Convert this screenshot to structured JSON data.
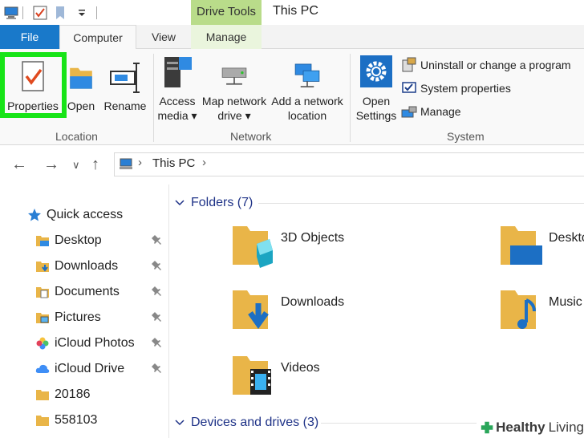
{
  "window": {
    "title": "This PC",
    "contextual_tab": "Drive Tools"
  },
  "tabs": {
    "file": "File",
    "computer": "Computer",
    "view": "View",
    "manage": "Manage"
  },
  "ribbon": {
    "location": {
      "label": "Location",
      "properties": "Properties",
      "open": "Open",
      "rename": "Rename"
    },
    "network": {
      "label": "Network",
      "access_media_1": "Access",
      "access_media_2": "media",
      "map_drive_1": "Map network",
      "map_drive_2": "drive",
      "add_location_1": "Add a network",
      "add_location_2": "location"
    },
    "system": {
      "label": "System",
      "open_settings_1": "Open",
      "open_settings_2": "Settings",
      "uninstall": "Uninstall or change a program",
      "system_properties": "System properties",
      "manage": "Manage"
    }
  },
  "address": {
    "path": "This PC"
  },
  "nav": {
    "quick_access": "Quick access",
    "items": [
      {
        "label": "Desktop",
        "pinned": true
      },
      {
        "label": "Downloads",
        "pinned": true
      },
      {
        "label": "Documents",
        "pinned": true
      },
      {
        "label": "Pictures",
        "pinned": true
      },
      {
        "label": "iCloud Photos",
        "pinned": true
      },
      {
        "label": "iCloud Drive",
        "pinned": true
      },
      {
        "label": "20186",
        "pinned": false
      },
      {
        "label": "558103",
        "pinned": false
      }
    ]
  },
  "content": {
    "folders_header": "Folders (7)",
    "devices_header": "Devices and drives (3)",
    "folders": [
      {
        "name": "3D Objects"
      },
      {
        "name": "Desktop"
      },
      {
        "name": "Downloads"
      },
      {
        "name": "Music"
      },
      {
        "name": "Videos"
      }
    ]
  },
  "watermark": {
    "brand": "Healthy",
    "brand2": "Living"
  },
  "colors": {
    "file_tab": "#1979ca",
    "drive_tools": "#b9dc8a",
    "highlight": "#17e417",
    "header_text": "#1e3287"
  }
}
